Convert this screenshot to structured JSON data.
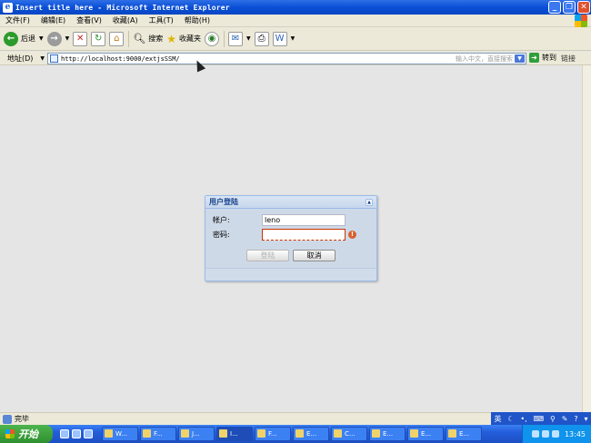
{
  "window": {
    "title": "Insert title here - Microsoft Internet Explorer",
    "minimize_glyph": "_",
    "maximize_glyph": "❐",
    "close_glyph": "✕"
  },
  "menu": [
    "文件(F)",
    "编辑(E)",
    "查看(V)",
    "收藏(A)",
    "工具(T)",
    "帮助(H)"
  ],
  "toolbar": {
    "back_label": "后退",
    "search_label": "搜索",
    "favorites_label": "收藏夹"
  },
  "address": {
    "label": "地址(D)",
    "url": "http://localhost:9000/extjsSSM/",
    "search_hint": "输入中文，直接搜索",
    "go_label": "转到",
    "links_label": "链接"
  },
  "login": {
    "title": "用户登陆",
    "account_label": "帐户:",
    "account_value": "leno",
    "password_label": "密码:",
    "password_value": "",
    "login_button": "登陆",
    "cancel_button": "取消",
    "error_glyph": "!"
  },
  "status": {
    "text": "完毕"
  },
  "langbar": {
    "lang": "英"
  },
  "taskbar": {
    "start_label": "开始",
    "tasks": [
      "W...",
      "F...",
      "J...",
      "I...",
      "F...",
      "E...",
      "C...",
      "E...",
      "E...",
      "E..."
    ],
    "clock": "13:45"
  }
}
